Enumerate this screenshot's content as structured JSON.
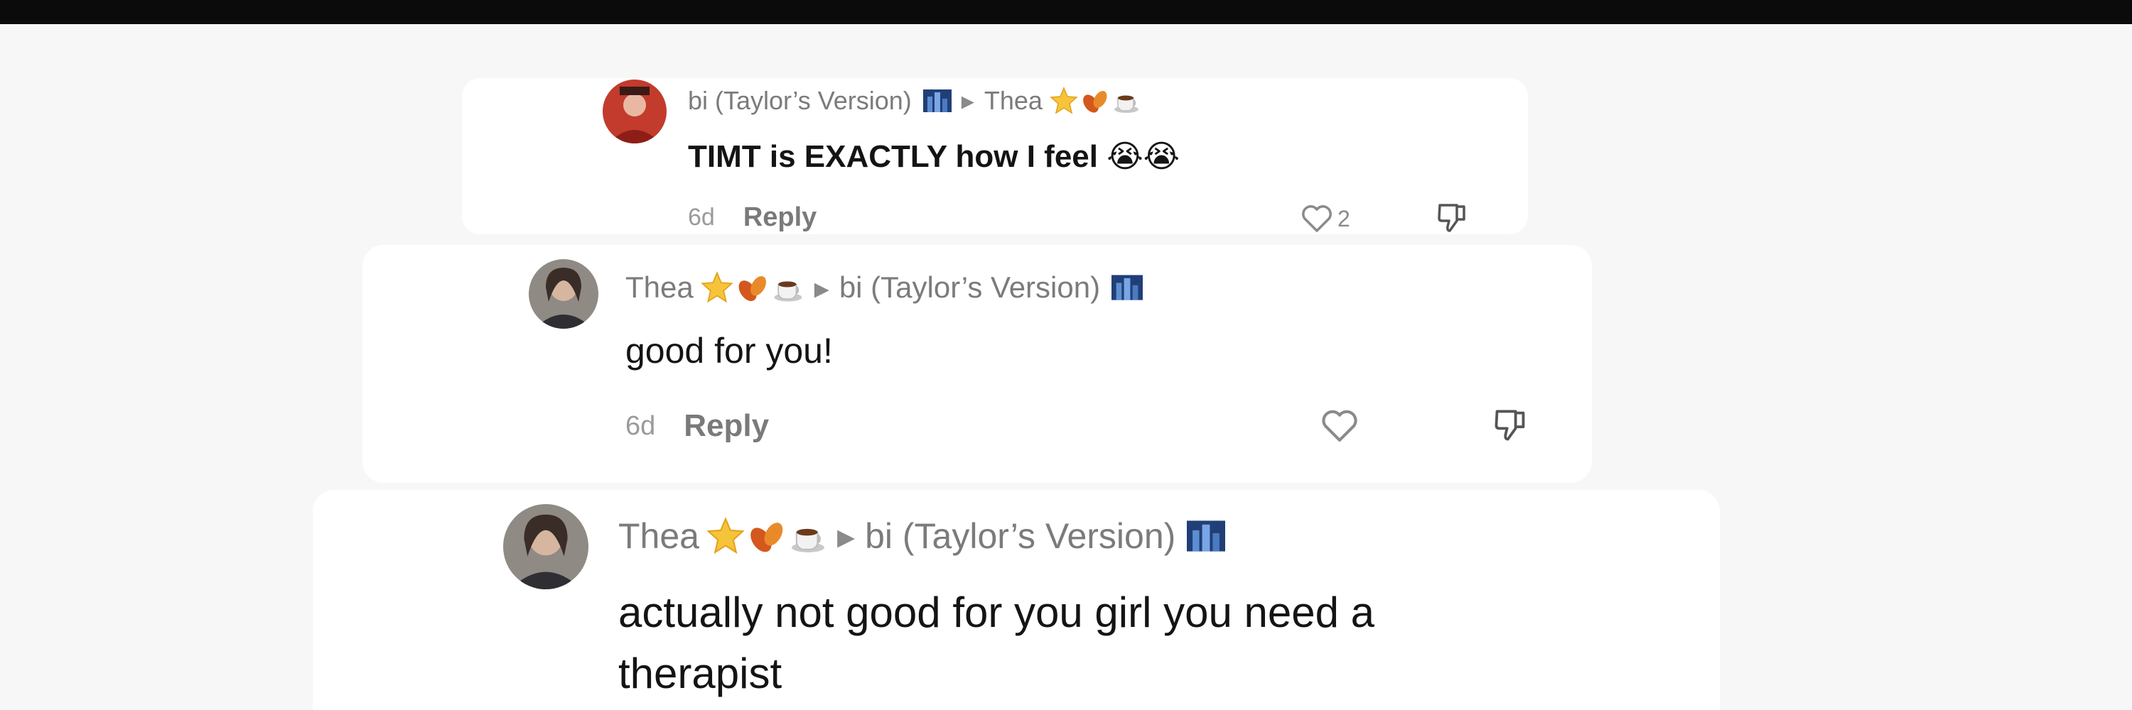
{
  "comments": [
    {
      "author": "bi (Taylor’s Version)",
      "reply_to": "Thea",
      "text": "TIMT is EXACTLY how I feel 😭😭",
      "age": "6d",
      "reply_label": "Reply",
      "like_count": "2"
    },
    {
      "author": "Thea",
      "reply_to": "bi (Taylor’s Version)",
      "text": "good for you!",
      "age": "6d",
      "reply_label": "Reply"
    },
    {
      "author": "Thea",
      "reply_to": "bi (Taylor’s Version)",
      "text_line1": "actually not good for you girl you need a",
      "text_line2": "therapist"
    }
  ],
  "arrow_glyph": "▸",
  "colors": {
    "page": "#f7f7f7",
    "card": "#ffffff",
    "topbar": "#0b0b0b",
    "username": "#7b7b7b",
    "body_text": "#141414",
    "meta": "#9a9a9a"
  },
  "icons": [
    "avatar",
    "star-emoji",
    "leaf-emoji",
    "coffee-emoji",
    "city-flag-emoji",
    "heart-icon",
    "dislike-icon",
    "crying-face-emoji"
  ]
}
